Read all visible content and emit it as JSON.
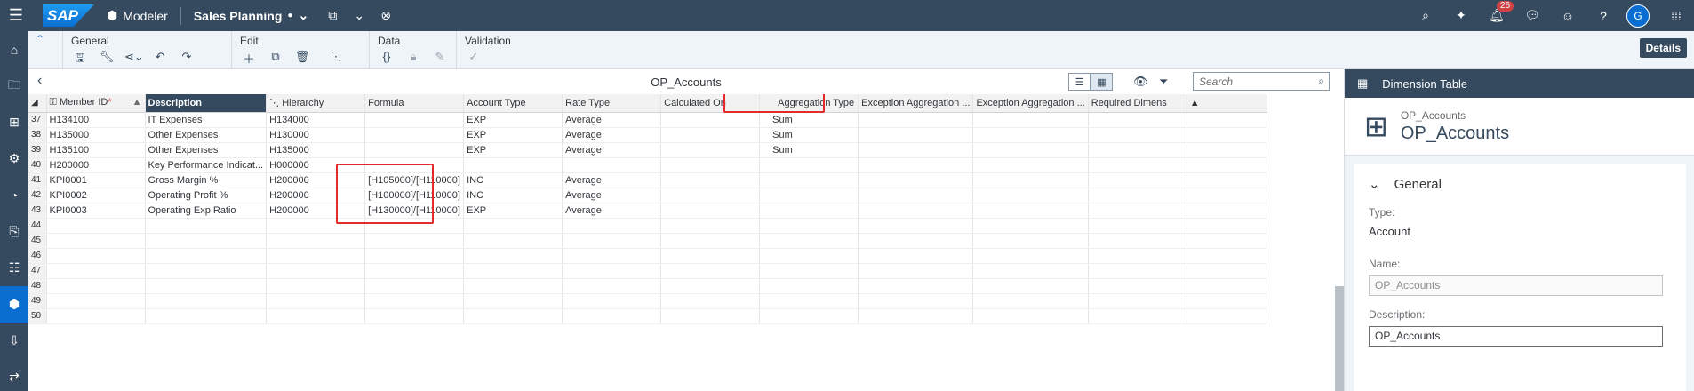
{
  "shell": {
    "app_name": "Modeler",
    "story_name": "Sales Planning",
    "notification_count": "26",
    "avatar_initial": "G"
  },
  "toolbar": {
    "groups": [
      {
        "title": "General"
      },
      {
        "title": "Edit"
      },
      {
        "title": "Data"
      },
      {
        "title": "Validation"
      }
    ],
    "details_label": "Details"
  },
  "grid_title": "OP_Accounts",
  "search_placeholder": "Search",
  "columns": [
    "Member ID",
    "Description",
    "Hierarchy",
    "Formula",
    "Account Type",
    "Rate Type",
    "Calculated On",
    "Aggregation Type",
    "Exception Aggregation ...",
    "Exception Aggregation ...",
    "Required Dimens"
  ],
  "rows": [
    {
      "n": "37",
      "id": "H134100",
      "desc": "IT Expenses",
      "hier": "H134000",
      "formula": "",
      "acct": "EXP",
      "rate": "Average",
      "calc": "",
      "agg": "Sum"
    },
    {
      "n": "38",
      "id": "H135000",
      "desc": "Other Expenses",
      "hier": "H130000",
      "formula": "",
      "acct": "EXP",
      "rate": "Average",
      "calc": "",
      "agg": "Sum"
    },
    {
      "n": "39",
      "id": "H135100",
      "desc": "Other Expenses",
      "hier": "H135000",
      "formula": "",
      "acct": "EXP",
      "rate": "Average",
      "calc": "",
      "agg": "Sum"
    },
    {
      "n": "40",
      "id": "H200000",
      "desc": "Key Performance Indicat...",
      "hier": "H000000",
      "formula": "",
      "acct": "",
      "rate": "",
      "calc": "",
      "agg": ""
    },
    {
      "n": "41",
      "id": "KPI0001",
      "desc": "Gross Margin %",
      "hier": "H200000",
      "formula": "[H105000]/[H110000]",
      "acct": "INC",
      "rate": "Average",
      "calc": "",
      "agg": ""
    },
    {
      "n": "42",
      "id": "KPI0002",
      "desc": "Operating Profit %",
      "hier": "H200000",
      "formula": "[H100000]/[H110000]",
      "acct": "INC",
      "rate": "Average",
      "calc": "",
      "agg": ""
    },
    {
      "n": "43",
      "id": "KPI0003",
      "desc": "Operating Exp Ratio",
      "hier": "H200000",
      "formula": "[H130000]/[H110000]",
      "acct": "EXP",
      "rate": "Average",
      "calc": "",
      "agg": ""
    },
    {
      "n": "44"
    },
    {
      "n": "45"
    },
    {
      "n": "46"
    },
    {
      "n": "47"
    },
    {
      "n": "48"
    },
    {
      "n": "49"
    },
    {
      "n": "50"
    }
  ],
  "panel": {
    "header": "Dimension Table",
    "object_subtitle": "OP_Accounts",
    "object_title": "OP_Accounts",
    "section": "General",
    "type_label": "Type:",
    "type_value": "Account",
    "name_label": "Name:",
    "name_value": "OP_Accounts",
    "desc_label": "Description:",
    "desc_value": "OP_Accounts"
  }
}
